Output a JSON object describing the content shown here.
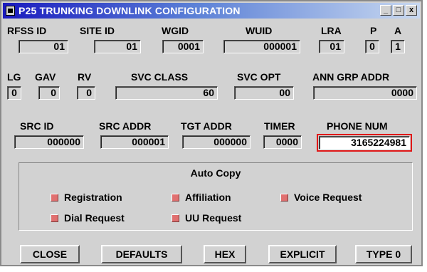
{
  "window": {
    "title": "P25 TRUNKING DOWNLINK CONFIGURATION",
    "minimize_glyph": "_",
    "maximize_glyph": "□",
    "close_glyph": "x"
  },
  "row1": {
    "rfss_id": {
      "label": "RFSS ID",
      "value": "01"
    },
    "site_id": {
      "label": "SITE ID",
      "value": "01"
    },
    "wgid": {
      "label": "WGID",
      "value": "0001"
    },
    "wuid": {
      "label": "WUID",
      "value": "000001"
    },
    "lra": {
      "label": "LRA",
      "value": "01"
    },
    "p": {
      "label": "P",
      "value": "0"
    },
    "a": {
      "label": "A",
      "value": "1"
    }
  },
  "row2": {
    "lg": {
      "label": "LG",
      "value": "0"
    },
    "gav": {
      "label": "GAV",
      "value": "0"
    },
    "rv": {
      "label": "RV",
      "value": "0"
    },
    "svc_class": {
      "label": "SVC CLASS",
      "value": "60"
    },
    "svc_opt": {
      "label": "SVC OPT",
      "value": "00"
    },
    "ann_grp_addr": {
      "label": "ANN GRP ADDR",
      "value": "0000"
    }
  },
  "row3": {
    "src_id": {
      "label": "SRC ID",
      "value": "000000"
    },
    "src_addr": {
      "label": "SRC ADDR",
      "value": "000001"
    },
    "tgt_addr": {
      "label": "TGT ADDR",
      "value": "000000"
    },
    "timer": {
      "label": "TIMER",
      "value": "0000"
    },
    "phone_num": {
      "label": "PHONE NUM",
      "value": "3165224981"
    }
  },
  "auto_copy": {
    "title": "Auto Copy",
    "checkbox_color": "#e07070",
    "items": {
      "registration": "Registration",
      "affiliation": "Affiliation",
      "voice_request": "Voice Request",
      "dial_request": "Dial Request",
      "uu_request": "UU Request"
    }
  },
  "buttons": {
    "close": "CLOSE",
    "defaults": "DEFAULTS",
    "hex": "HEX",
    "explicit": "EXPLICIT",
    "type0": "TYPE 0"
  },
  "colors": {
    "window_bg": "#d2d2d2",
    "titlebar_start": "#1a1abf",
    "active_field_outline": "#e01818"
  }
}
